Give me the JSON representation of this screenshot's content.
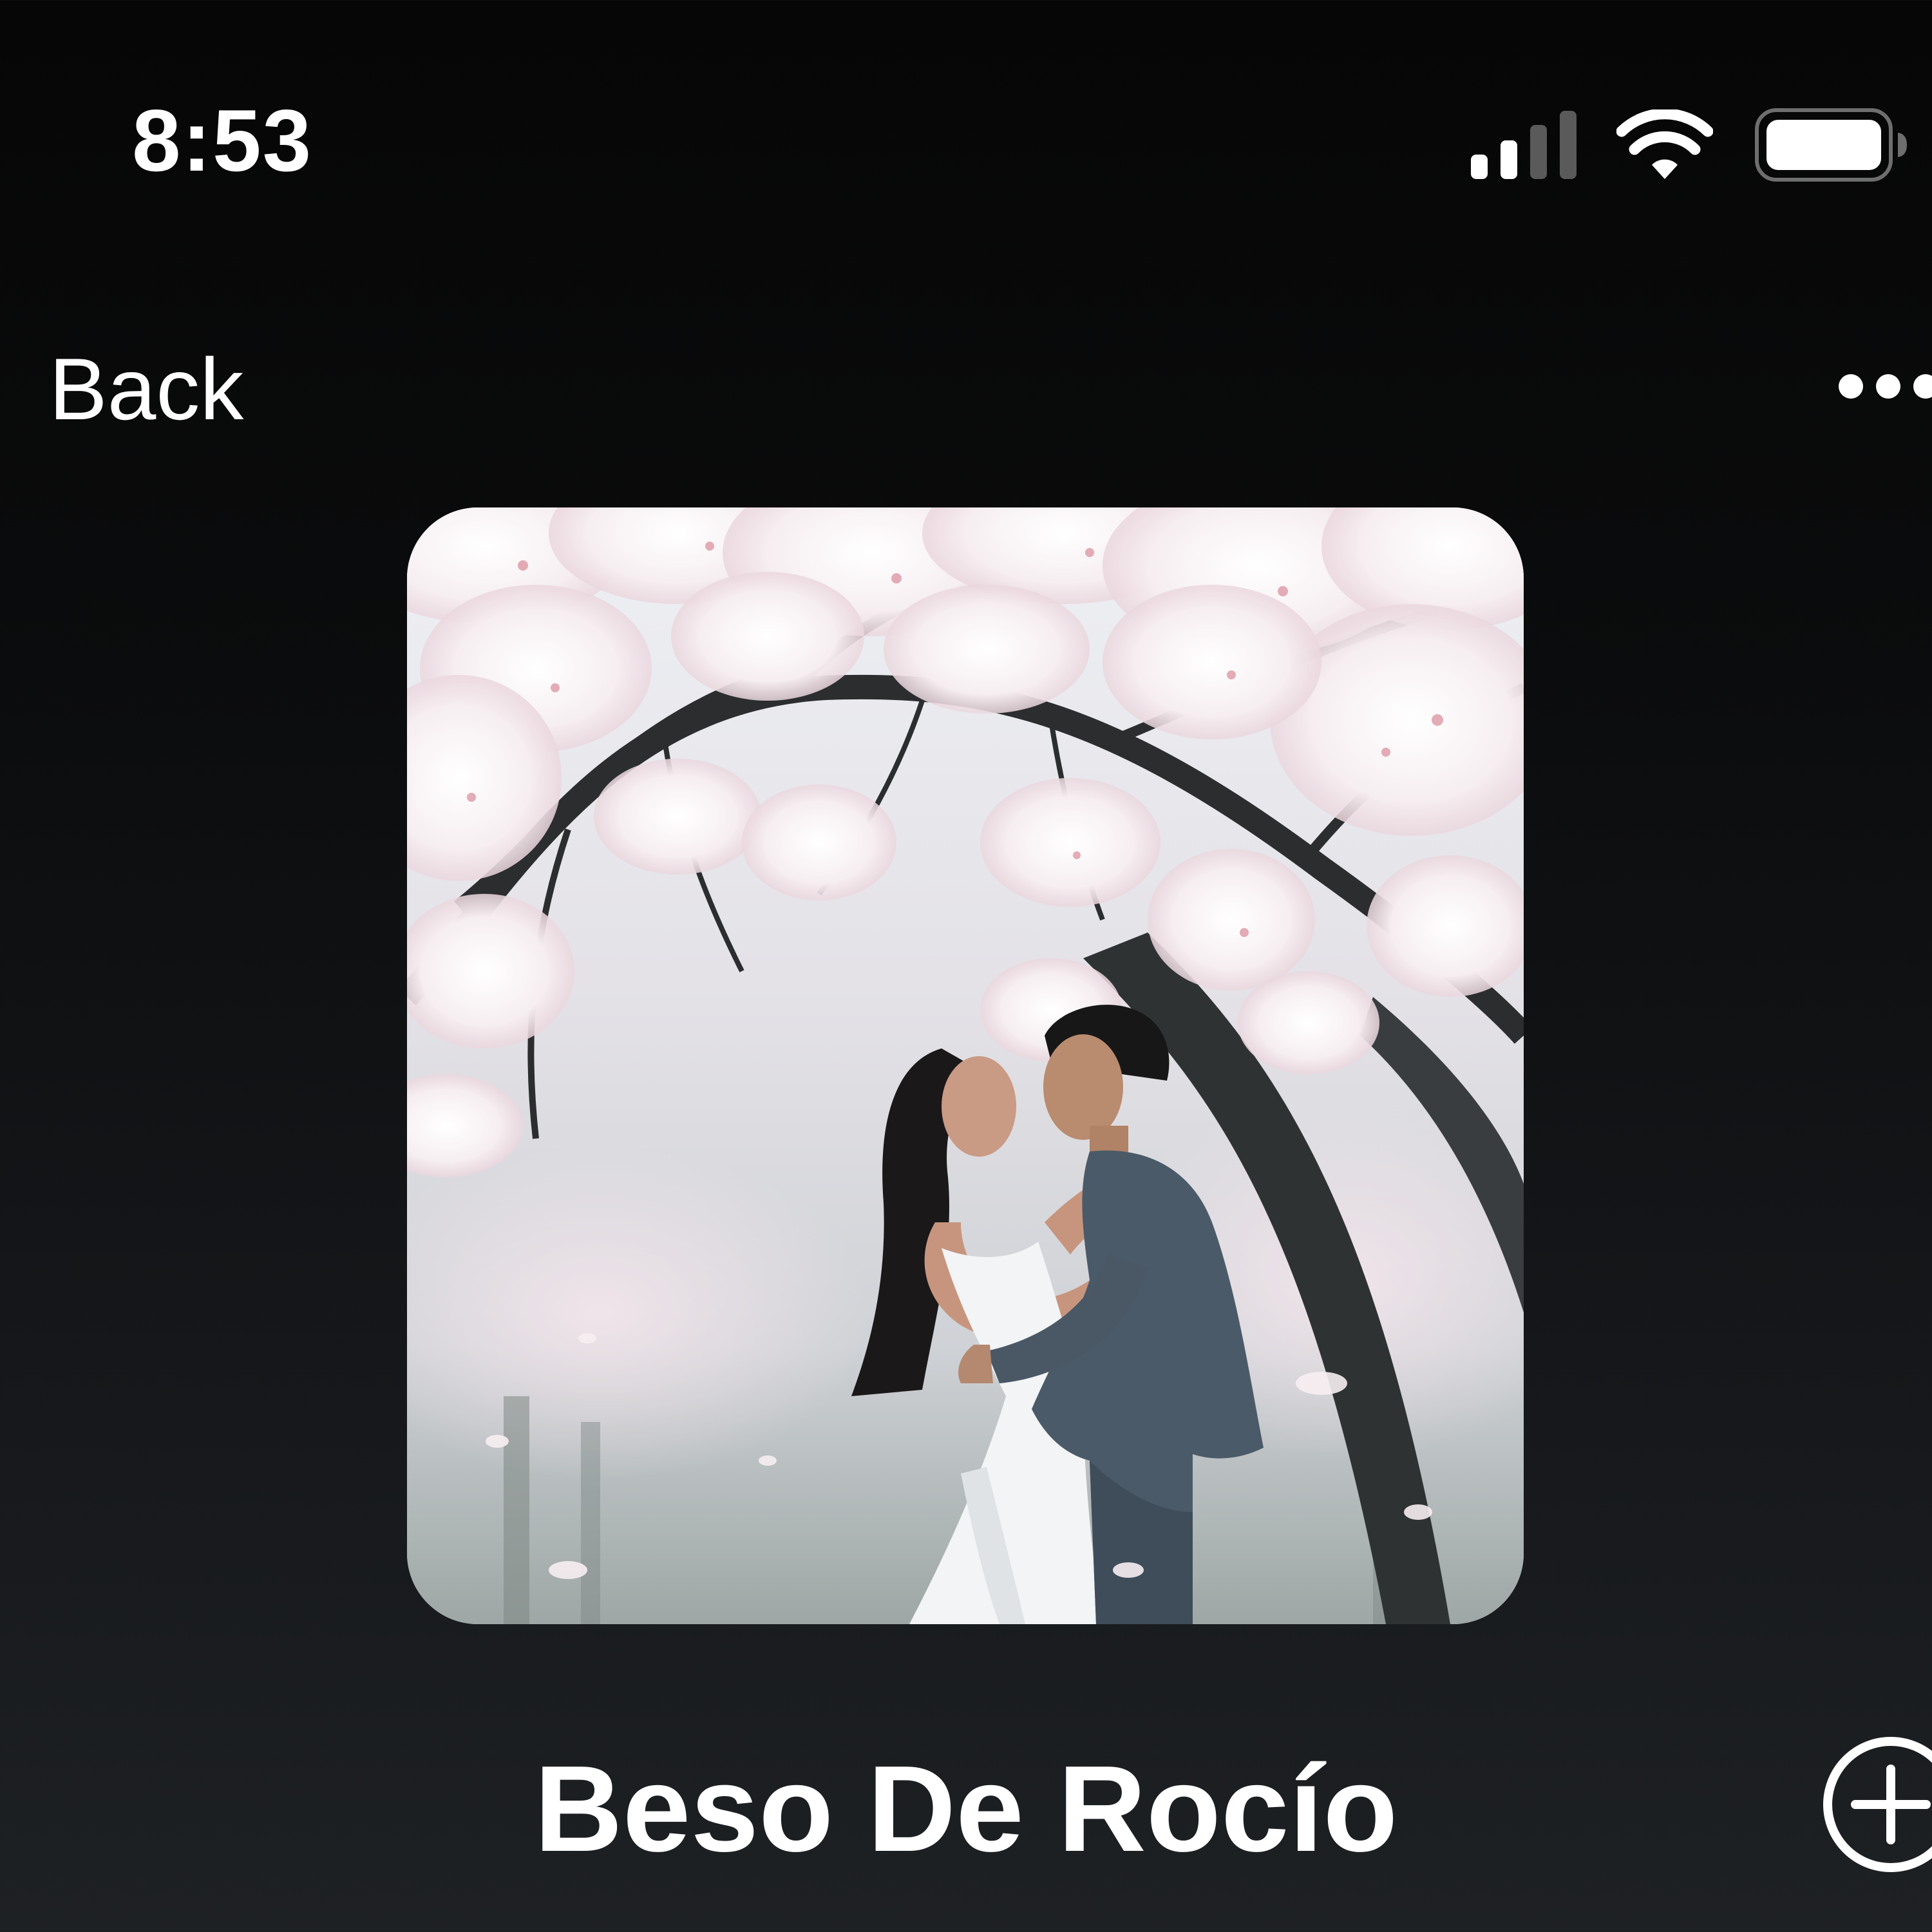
{
  "status_bar": {
    "time": "8:53",
    "signal_icon": "cellular-signal-icon",
    "wifi_icon": "wifi-icon",
    "battery_icon": "battery-icon"
  },
  "nav": {
    "back_label": "Back",
    "more_icon": "ellipsis-icon"
  },
  "artwork": {
    "icon": "album-artwork"
  },
  "song": {
    "title": "Beso De Rocío",
    "add_icon": "plus-circle-icon"
  },
  "colors": {
    "background_top": "#060606",
    "background_bottom": "#1e2124",
    "text": "#ffffff"
  }
}
